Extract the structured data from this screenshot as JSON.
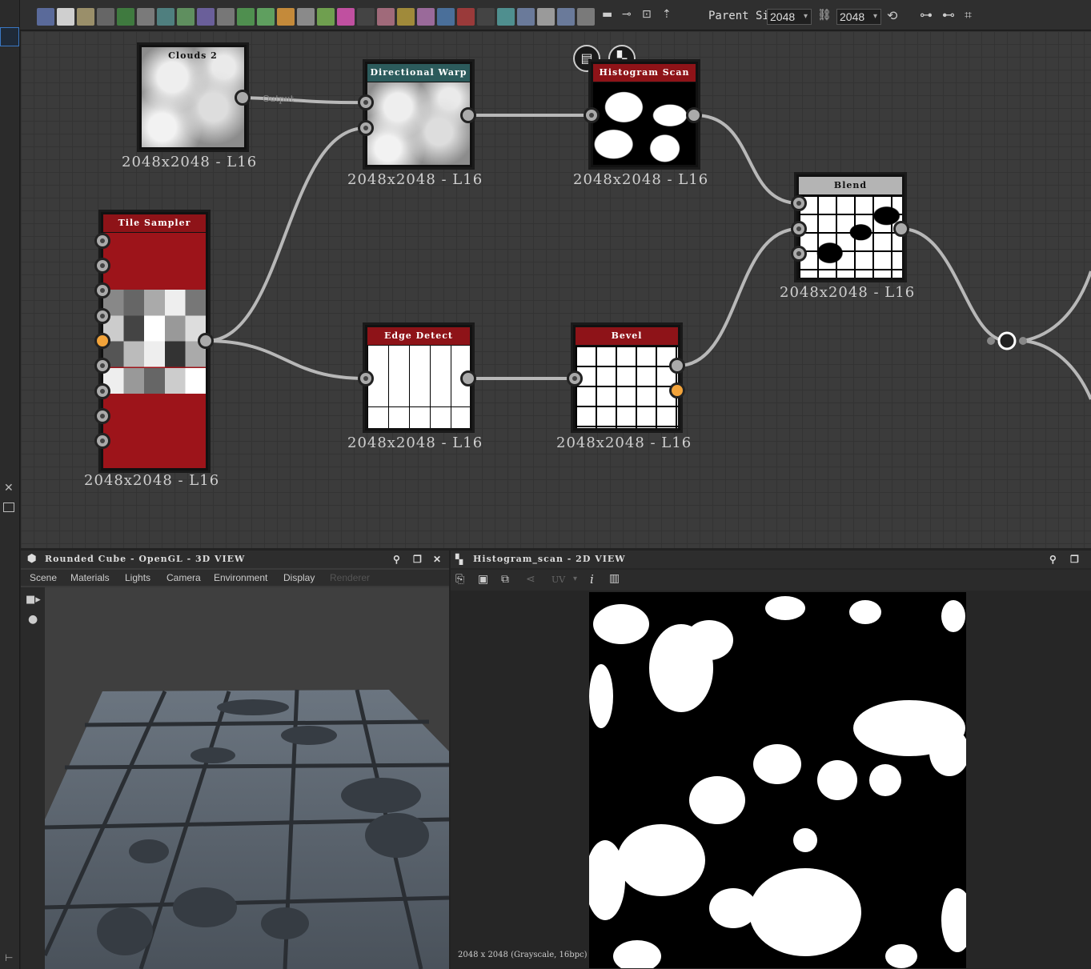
{
  "toolbar": {
    "parent_size_label": "Parent Size:",
    "width_value": "2048",
    "height_value": "2048"
  },
  "graph": {
    "nodes": {
      "clouds2": {
        "title": "Clouds 2",
        "label": "2048x2048 - L16",
        "output_label": "Output"
      },
      "directional_warp": {
        "title": "Directional Warp",
        "label": "2048x2048 - L16"
      },
      "histogram_scan": {
        "title": "Histogram Scan",
        "label": "2048x2048 - L16"
      },
      "blend": {
        "title": "Blend",
        "label": "2048x2048 - L16"
      },
      "tile_sampler": {
        "title": "Tile Sampler",
        "label": "2048x2048 - L16"
      },
      "edge_detect": {
        "title": "Edge Detect",
        "label": "2048x2048 - L16"
      },
      "bevel": {
        "title": "Bevel",
        "label": "2048x2048 - L16"
      }
    },
    "colors": {
      "red_header": "#8e1318",
      "teal_header": "#2c5b5c",
      "grey_header": "#b4b4b4",
      "wire": "#b8b8b8",
      "port_orange": "#f2a33a"
    }
  },
  "view3d": {
    "title": "Rounded Cube - OpenGL - 3D VIEW",
    "menu": [
      "Scene",
      "Materials",
      "Lights",
      "Camera",
      "Environment",
      "Display",
      "Renderer"
    ]
  },
  "view2d": {
    "title": "Histogram_scan - 2D VIEW",
    "uv_label": "UV",
    "status": "2048 x 2048 (Grayscale, 16bpc)"
  }
}
